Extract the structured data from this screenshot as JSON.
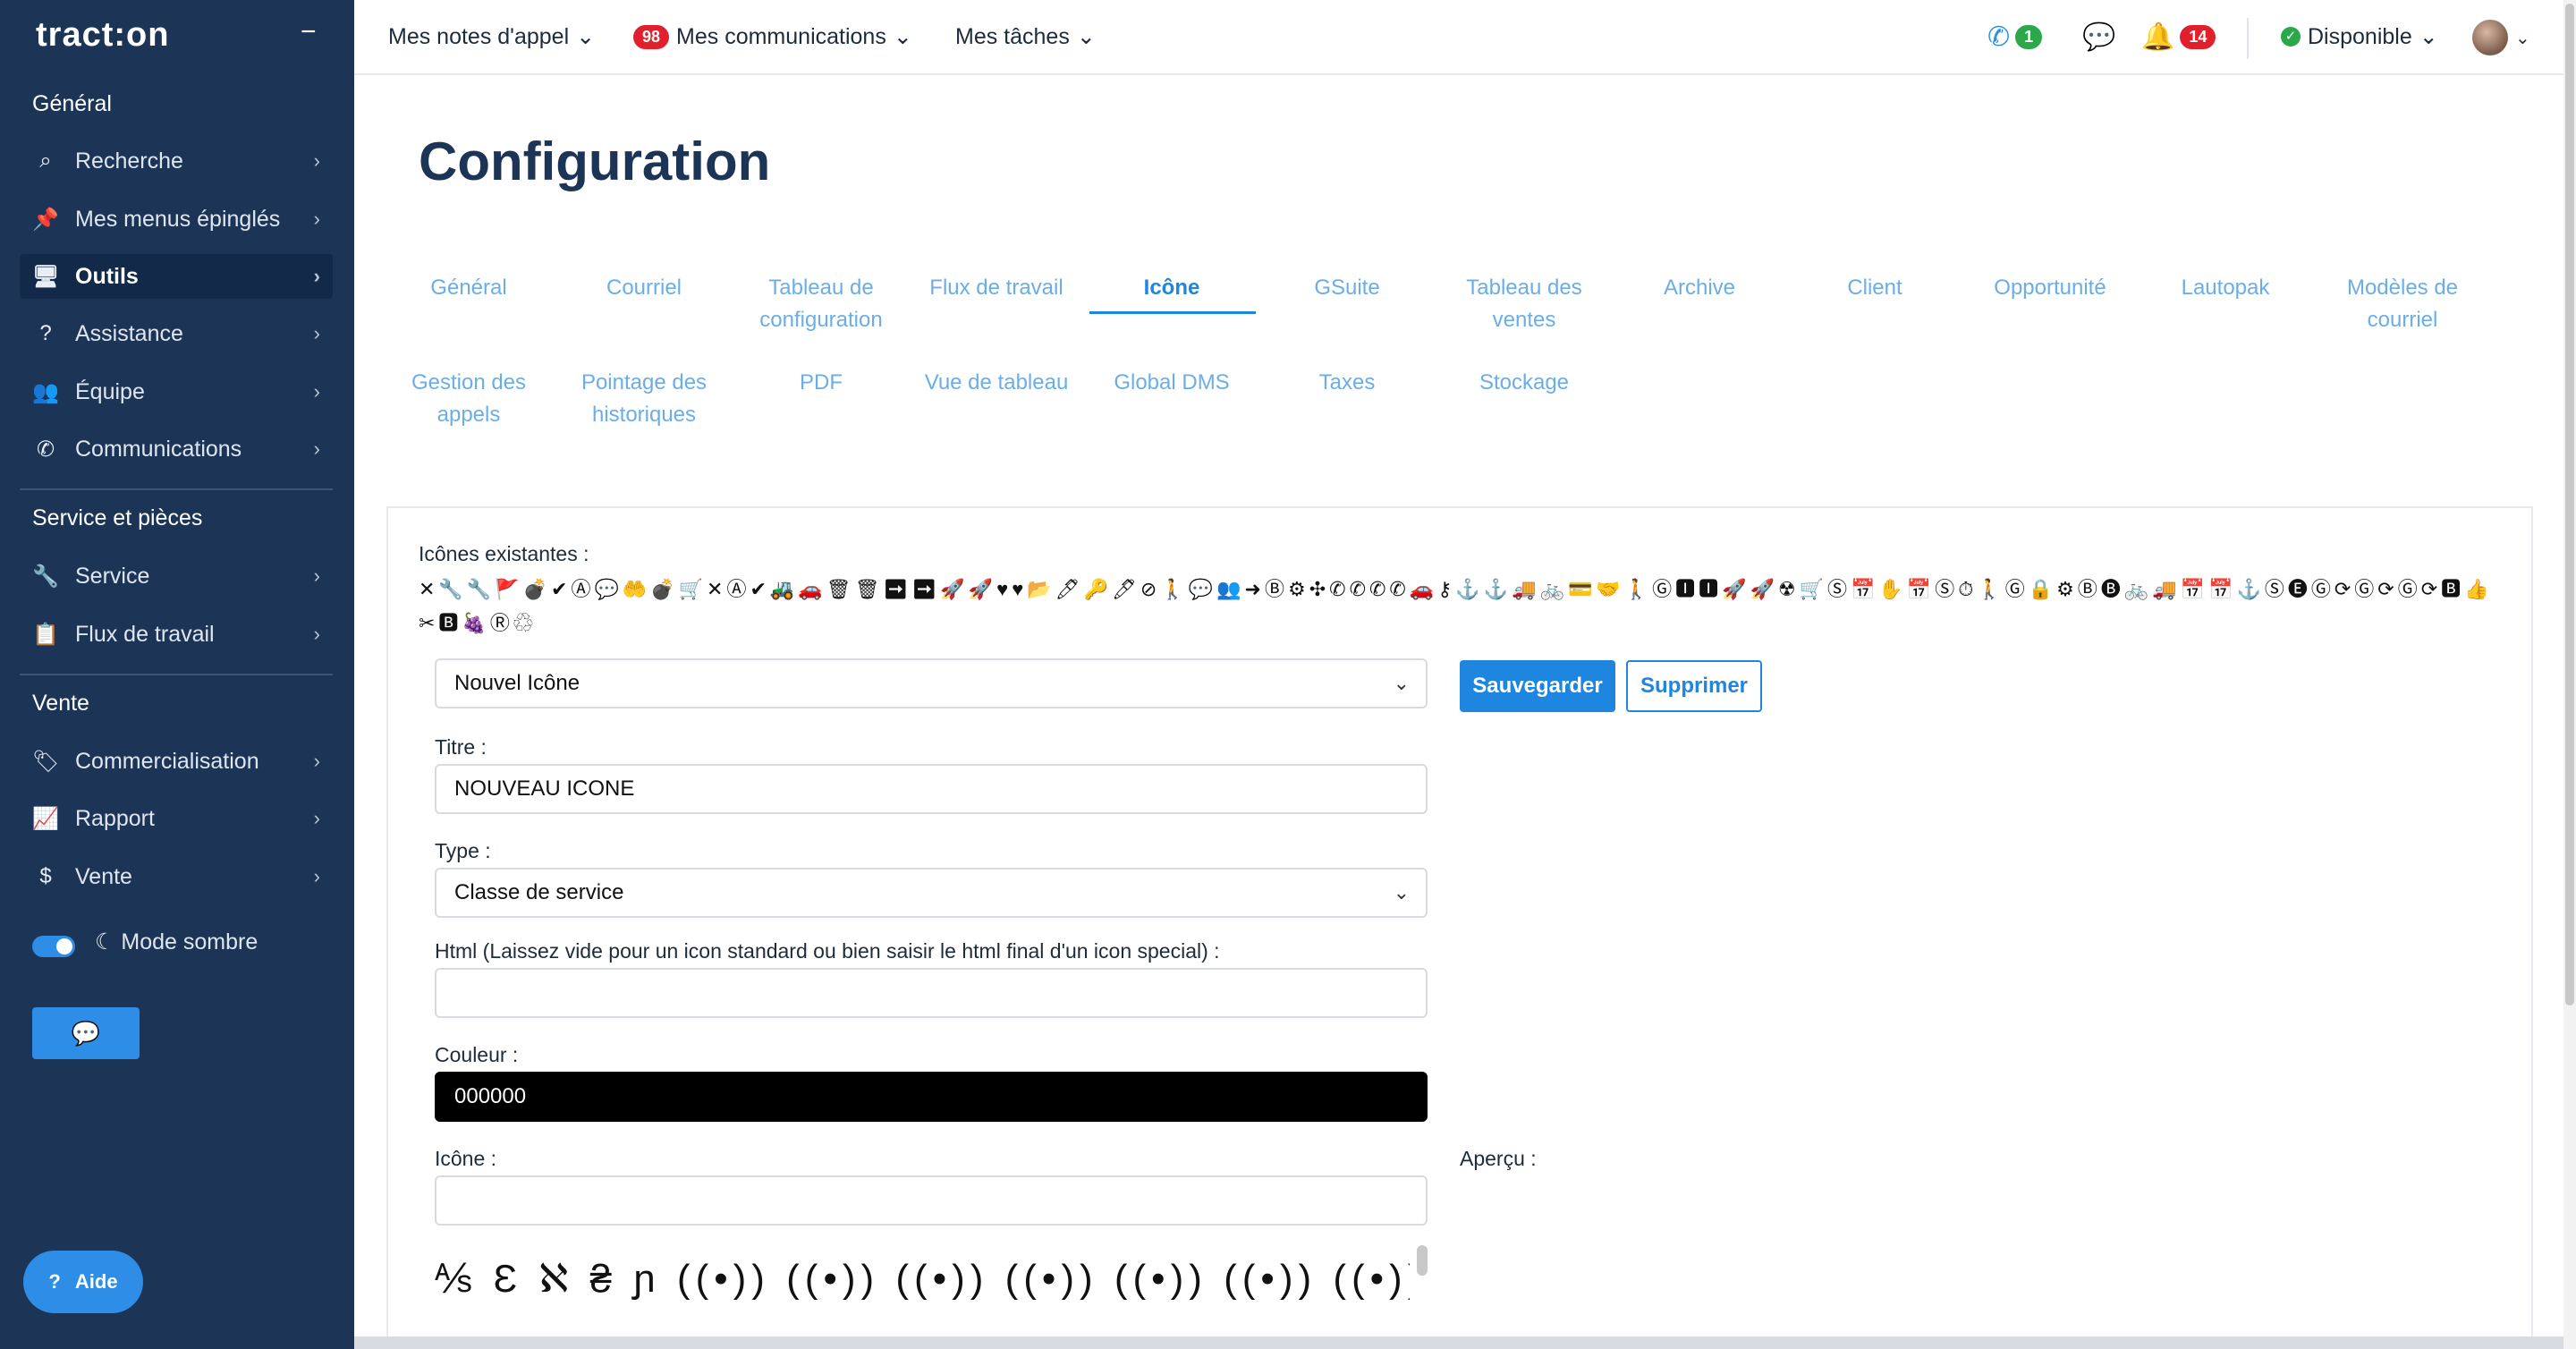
{
  "app": {
    "logo": "tract:on",
    "collapse_icon": "−"
  },
  "sidebar": {
    "sections": [
      {
        "title": "Général"
      },
      {
        "title": "Service et pièces"
      },
      {
        "title": "Vente"
      }
    ],
    "general_items": [
      {
        "label": "Recherche",
        "icon": "⌕"
      },
      {
        "label": "Mes menus épinglés",
        "icon": "📌"
      },
      {
        "label": "Outils",
        "icon": "🖥"
      },
      {
        "label": "Assistance",
        "icon": "?"
      },
      {
        "label": "Équipe",
        "icon": "👥"
      },
      {
        "label": "Communications",
        "icon": "✆"
      }
    ],
    "service_items": [
      {
        "label": "Service",
        "icon": "🔧"
      },
      {
        "label": "Flux de travail",
        "icon": "📋"
      }
    ],
    "vente_items": [
      {
        "label": "Commercialisation",
        "icon": "🏷"
      },
      {
        "label": "Rapport",
        "icon": "📈"
      },
      {
        "label": "Vente",
        "icon": "$"
      }
    ],
    "chevron": "›",
    "dark_mode_label": "Mode sombre",
    "moon_icon": "☾",
    "chat_icon": "💬",
    "help_label": "Aide",
    "help_icon": "?"
  },
  "topbar": {
    "menus": [
      {
        "label": "Mes notes d'appel"
      },
      {
        "label": "Mes communications",
        "badge": "98"
      },
      {
        "label": "Mes tâches"
      }
    ],
    "chevron_down": "⌄",
    "phone_badge": "1",
    "phone_icon": "✆",
    "chat_icon": "💬",
    "bell_icon": "🔔",
    "bell_badge": "14",
    "status_label": "Disponible",
    "status_check": "✓"
  },
  "page": {
    "title": "Configuration",
    "tabs_row1": [
      "Général",
      "Courriel",
      "Tableau de configuration",
      "Flux de travail",
      "Icône",
      "GSuite",
      "Tableau des ventes",
      "Archive",
      "Client",
      "Opportunité",
      "Lautopak",
      "Modèles de courriel"
    ],
    "tabs_row2": [
      "Gestion des appels",
      "Pointage des historiques",
      "PDF",
      "Vue de tableau",
      "Global DMS",
      "Taxes",
      "Stockage"
    ],
    "active_tab": "Icône"
  },
  "form": {
    "existing_label": "Icônes existantes :",
    "existing_icons": "✕🔧🔧🚩💣✔Ⓐ💬🤲💣🛒✕Ⓐ✔🚜🚗🗑🗑➡➡🚀🚀♥♥📂🖊🔑🖊⊘🚶💬👥➜Ⓑ⚙✣✆✆✆✆🚗⚷⚓⚓🚚🚲💳🤝🚶Ⓖ🅸🅸🚀🚀☢🛒Ⓢ📅✋📅Ⓢ⏱🚶Ⓖ🔒⚙Ⓑ🅑🚲🚚📅📅⚓Ⓢ🅔Ⓖ⟳Ⓖ⟳Ⓖ⟳🅱👍✂🅱🍇Ⓡ♲",
    "icon_select": "Nouvel Icône",
    "save_label": "Sauvegarder",
    "delete_label": "Supprimer",
    "title_label": "Titre :",
    "title_value": "NOUVEAU ICONE",
    "type_label": "Type :",
    "type_value": "Classe de service",
    "html_label": "Html (Laissez vide pour un icon standard ou bien saisir le html final d'un icon special) :",
    "html_value": "",
    "color_label": "Couleur :",
    "color_value": "000000",
    "icon_label": "Icône :",
    "icon_value": "",
    "preview_label": "Aperçu :",
    "glyphs": "⅍ Ɛ ℵ ₴ ɲ ((•)) ((•)) ((•)) ((•)) ((•)) ((•)) ((•)) ((•)) 👤 👤 👤 👤 👤 👤 👤 👤",
    "glyphs2": "▬ ▬ ▬ ▬ ▬ ▬ ▬ ▬ ▬"
  },
  "colors": {
    "sidebar": "#1c3557",
    "accent": "#1f86e0",
    "tab": "#6aaee8",
    "badge": "#e0202c",
    "ok": "#2aa84a"
  }
}
